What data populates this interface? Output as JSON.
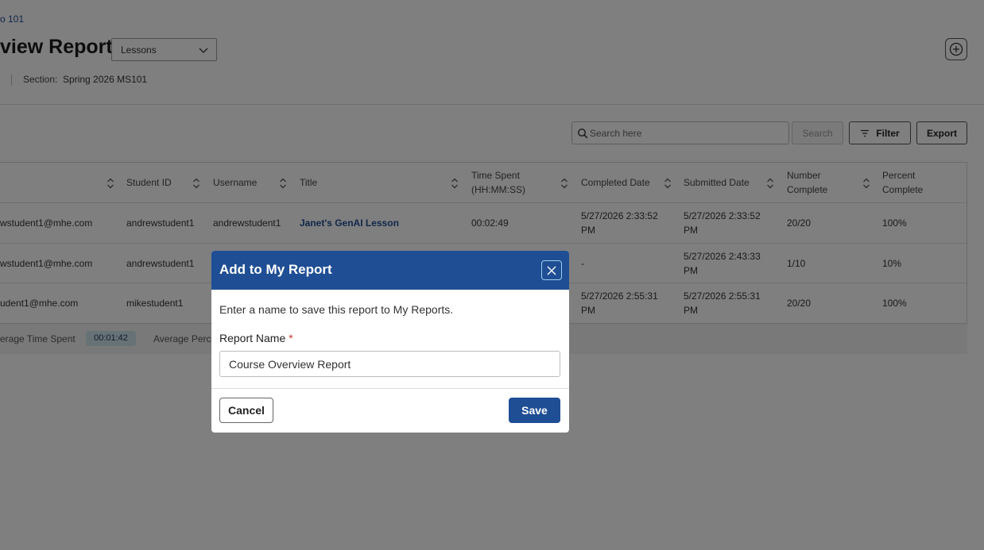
{
  "header": {
    "breadcrumb": "o 101",
    "title": "view Report",
    "view_select": {
      "selected": "Lessons"
    },
    "section_label": "Section:",
    "section_value": "Spring 2026 MS101"
  },
  "toolbar": {
    "search_placeholder": "Search here",
    "search_button": "Search",
    "filter_button": "Filter",
    "export_button": "Export"
  },
  "table": {
    "columns": [
      "Student ID",
      "Username",
      "Title",
      "Time Spent (HH:MM:SS)",
      "Completed Date",
      "Submitted Date",
      "Number Complete",
      "Percent Complete"
    ],
    "column_lines": {
      "time_spent": [
        "Time Spent",
        "(HH:MM:SS)"
      ],
      "number_complete": [
        "Number",
        "Complete"
      ],
      "percent_complete": [
        "Percent",
        "Complete"
      ]
    },
    "rows": [
      {
        "email": "wstudent1@mhe.com",
        "student_id": "andrewstudent1",
        "username": "andrewstudent1",
        "title": "Janet's GenAI Lesson",
        "time_spent": "00:02:49",
        "completed_date": [
          "5/27/2026 2:33:52",
          "PM"
        ],
        "submitted_date": [
          "5/27/2026 2:33:52",
          "PM"
        ],
        "number_complete": "20/20",
        "percent_complete": "100%"
      },
      {
        "email": "wstudent1@mhe.com",
        "student_id": "andrewstudent1",
        "completed_date": [
          "-"
        ],
        "submitted_date": [
          "5/27/2026 2:43:33",
          "PM"
        ],
        "number_complete": "1/10",
        "percent_complete": "10%"
      },
      {
        "email": "udent1@mhe.com",
        "student_id": "mikestudent1",
        "completed_date": [
          "5/27/2026 2:55:31",
          "PM"
        ],
        "submitted_date": [
          "5/27/2026 2:55:31",
          "PM"
        ],
        "number_complete": "20/20",
        "percent_complete": "100%"
      }
    ]
  },
  "summary": {
    "avg_time_label": "erage Time Spent",
    "avg_time_value": "00:01:42",
    "avg_percent_label": "Average Perc"
  },
  "modal": {
    "title": "Add to My Report",
    "description": "Enter a name to save this report to My Reports.",
    "field_label": "Report Name",
    "required_mark": "*",
    "input_value": "Course Overview Report",
    "cancel_label": "Cancel",
    "save_label": "Save"
  },
  "colors": {
    "brand_blue": "#1f4e94",
    "link_blue": "#1e4c97",
    "close_outline": "#9fd1ee",
    "required_red": "#c0392b",
    "summary_pill": "#cfe4ee"
  }
}
